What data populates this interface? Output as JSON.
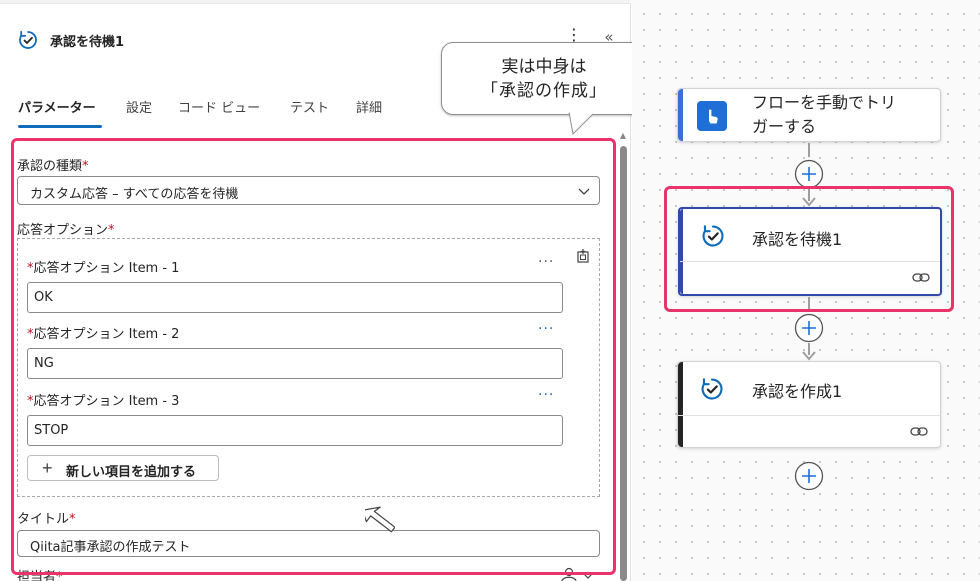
{
  "panel": {
    "title": "承認を待機1",
    "tabs": [
      {
        "label": "パラメーター",
        "active": true
      },
      {
        "label": "設定"
      },
      {
        "label": "コード ビュー"
      },
      {
        "label": "テスト"
      },
      {
        "label": "詳細"
      }
    ],
    "approval_type": {
      "label": "承認の種類",
      "required_mark": "*",
      "value": "カスタム応答 – すべての応答を待機"
    },
    "response_options": {
      "label": "応答オプション",
      "required_mark": "*",
      "items": [
        {
          "label": "応答オプション Item - 1",
          "value": "OK"
        },
        {
          "label": "応答オプション Item - 2",
          "value": "NG"
        },
        {
          "label": "応答オプション Item - 3",
          "value": "STOP"
        }
      ],
      "add_button": "新しい項目を追加する",
      "more_glyph": "···"
    },
    "title_field": {
      "label": "タイトル",
      "required_mark": "*",
      "value": "Qiita記事承認の作成テスト"
    },
    "assignee": {
      "label": "担当者",
      "required_mark": "*"
    }
  },
  "callout": {
    "line1": "実は中身は",
    "line2": "「承認の作成」"
  },
  "canvas": {
    "trigger_card": {
      "title_line1": "フローを手動でトリ",
      "title_line2": "ガーする",
      "icon": "hand-touch-icon"
    },
    "wait_card": {
      "title": "承認を待機1",
      "icon": "approval-icon"
    },
    "create_card": {
      "title": "承認を作成1",
      "icon": "approval-icon"
    }
  },
  "colors": {
    "accent": "#0f6cbd",
    "highlight": "#e8336b",
    "required": "#c50f1f",
    "approval_icon": "#0f6cbd",
    "trigger_icon_bg": "#1f6fd6"
  }
}
